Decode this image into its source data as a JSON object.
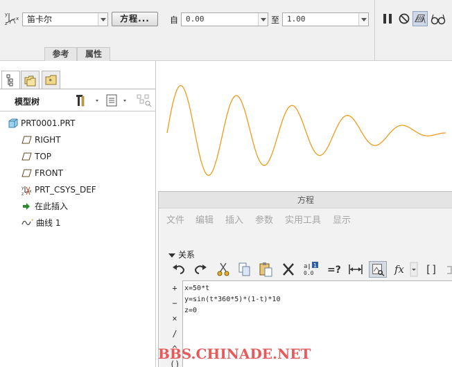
{
  "ribbon": {
    "coord_type": "笛卡尔",
    "equation_button": "方程...",
    "from_label": "自",
    "from_value": "0.00",
    "to_label": "至",
    "to_value": "1.00",
    "tabs": [
      "参考",
      "属性"
    ],
    "icons": [
      "pause-icon",
      "cancel-icon",
      "preview-icon",
      "glasses-icon"
    ]
  },
  "left_panel": {
    "panel_tabs": [
      "model-tree-icon",
      "folder-browser-icon",
      "favorites-icon"
    ],
    "tree_title": "模型树",
    "tree_items": [
      {
        "label": "PRT0001.PRT",
        "icon": "part-icon"
      },
      {
        "label": "RIGHT",
        "icon": "datum-plane-icon"
      },
      {
        "label": "TOP",
        "icon": "datum-plane-icon"
      },
      {
        "label": "FRONT",
        "icon": "datum-plane-icon"
      },
      {
        "label": "PRT_CSYS_DEF",
        "icon": "csys-icon"
      },
      {
        "label": "在此插入",
        "icon": "insert-arrow-icon"
      },
      {
        "label": "曲线 1",
        "icon": "curve-icon"
      }
    ]
  },
  "equation_dialog": {
    "title": "方程",
    "menu": [
      "文件",
      "编辑",
      "插入",
      "参数",
      "实用工具",
      "显示"
    ],
    "section": "关系",
    "side_ops": [
      "+",
      "−",
      "×",
      "/",
      "^",
      "()"
    ],
    "equations": [
      "x=50*t",
      "y=sin(t*360*5)*(1-t)*10",
      "z=0"
    ],
    "toolbar_icons": [
      "undo-icon",
      "redo-icon",
      "cut-icon",
      "copy-icon",
      "paste-icon",
      "delete-icon",
      "sort-icon",
      "verify-icon",
      "dimension-icon",
      "display-icon",
      "function-icon",
      "brackets-icon"
    ]
  },
  "watermark": "BBS.CHINADE.NET",
  "colors": {
    "curve": "#f09a1a",
    "watermark": "#e85a5a",
    "insert_arrow": "#2e8b2e"
  }
}
